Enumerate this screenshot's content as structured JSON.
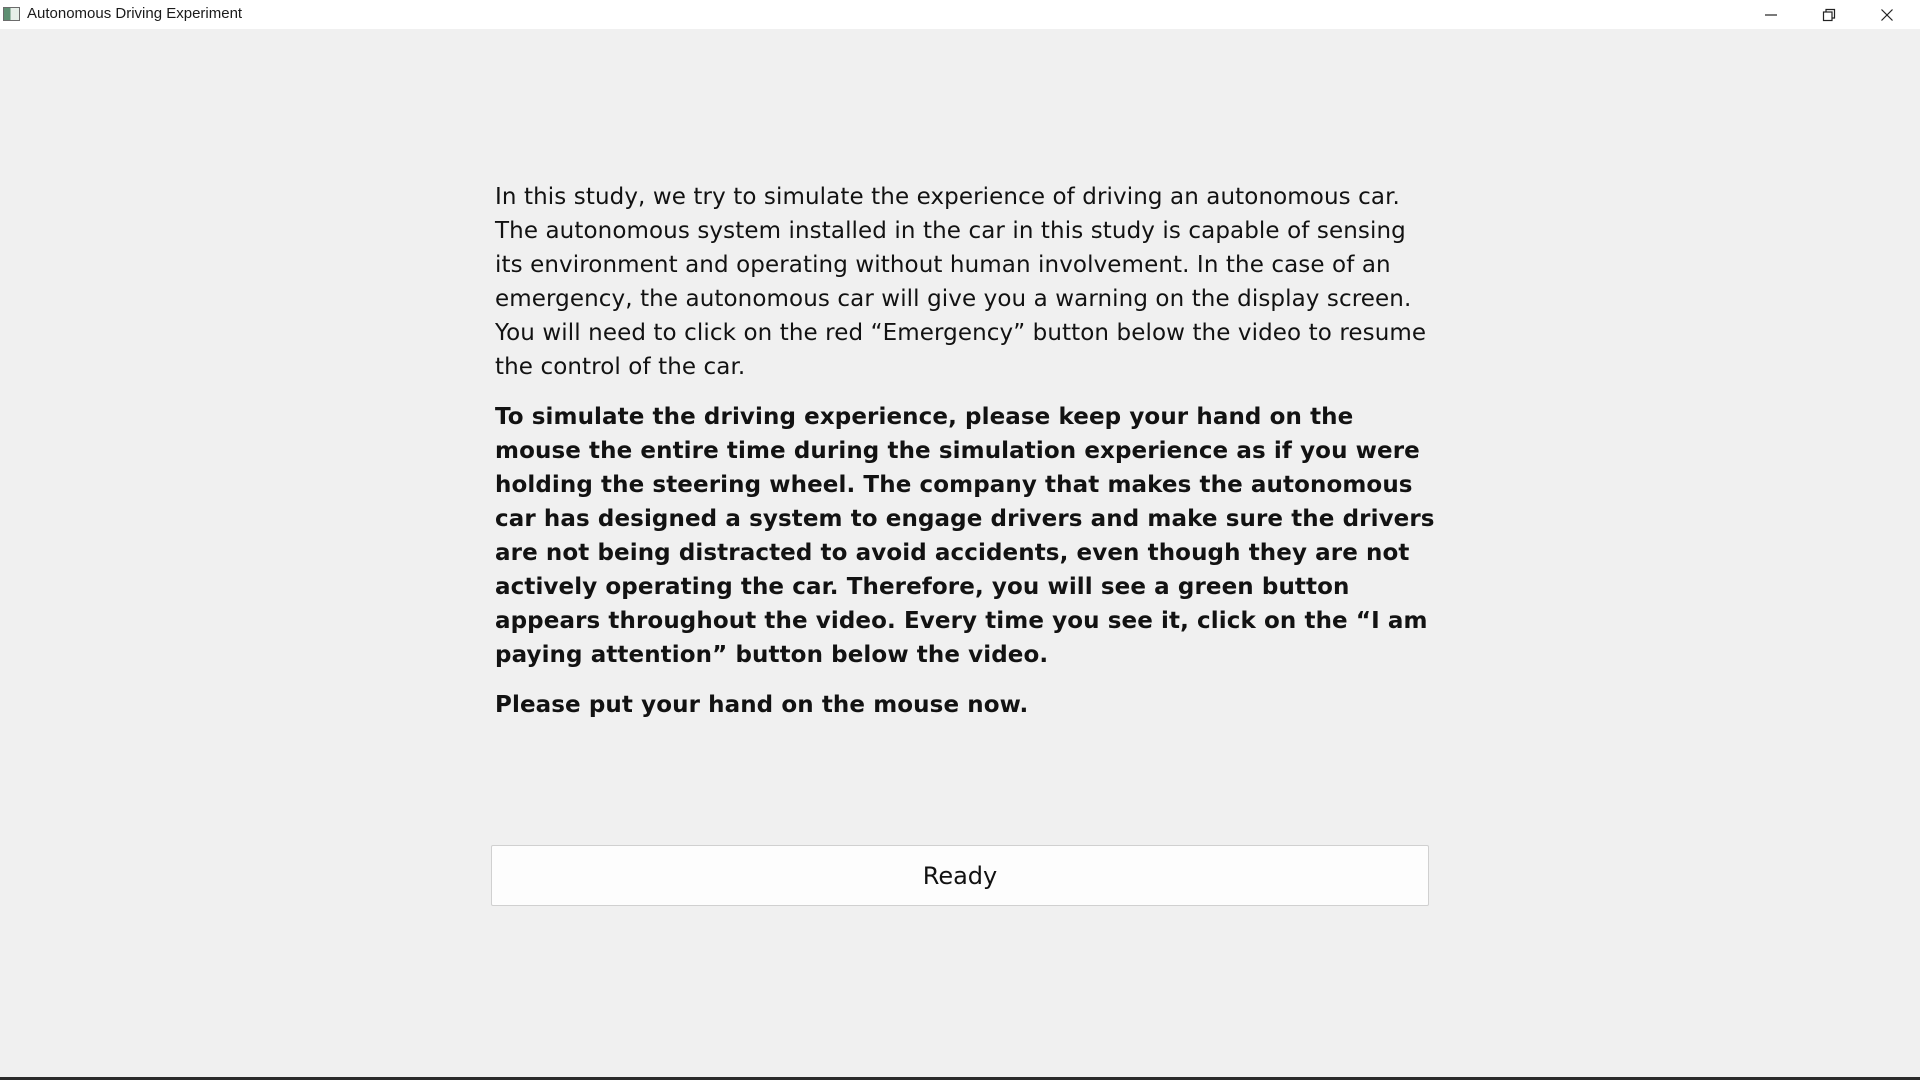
{
  "window": {
    "title": "Autonomous Driving Experiment",
    "icons": {
      "app": "app-window-icon",
      "minimize": "minimize-icon",
      "maximize": "restore-icon",
      "close": "close-icon"
    }
  },
  "instructions": {
    "paragraph1": "In this study, we try to simulate the experience of driving an autonomous car. The autonomous system installed in the car in this study is capable of sensing its environment and operating without human involvement. In the case of an emergency, the autonomous car will give you a warning on the display screen. You will need to click on the red “Emergency” button below the video to resume the control of the car.",
    "paragraph2": "To simulate the driving experience, please keep your hand on the mouse the entire time during the simulation experience as if you were holding the steering wheel. The company that makes the autonomous car has designed a system to engage drivers and make sure the drivers are not being distracted to avoid accidents, even though they are not actively operating the car. Therefore, you will see a green button appears throughout the video. Every time you see it, click on the “I am paying attention” button below the video.",
    "paragraph3": "Please put your hand on the mouse now."
  },
  "actions": {
    "ready_label": "Ready"
  }
}
